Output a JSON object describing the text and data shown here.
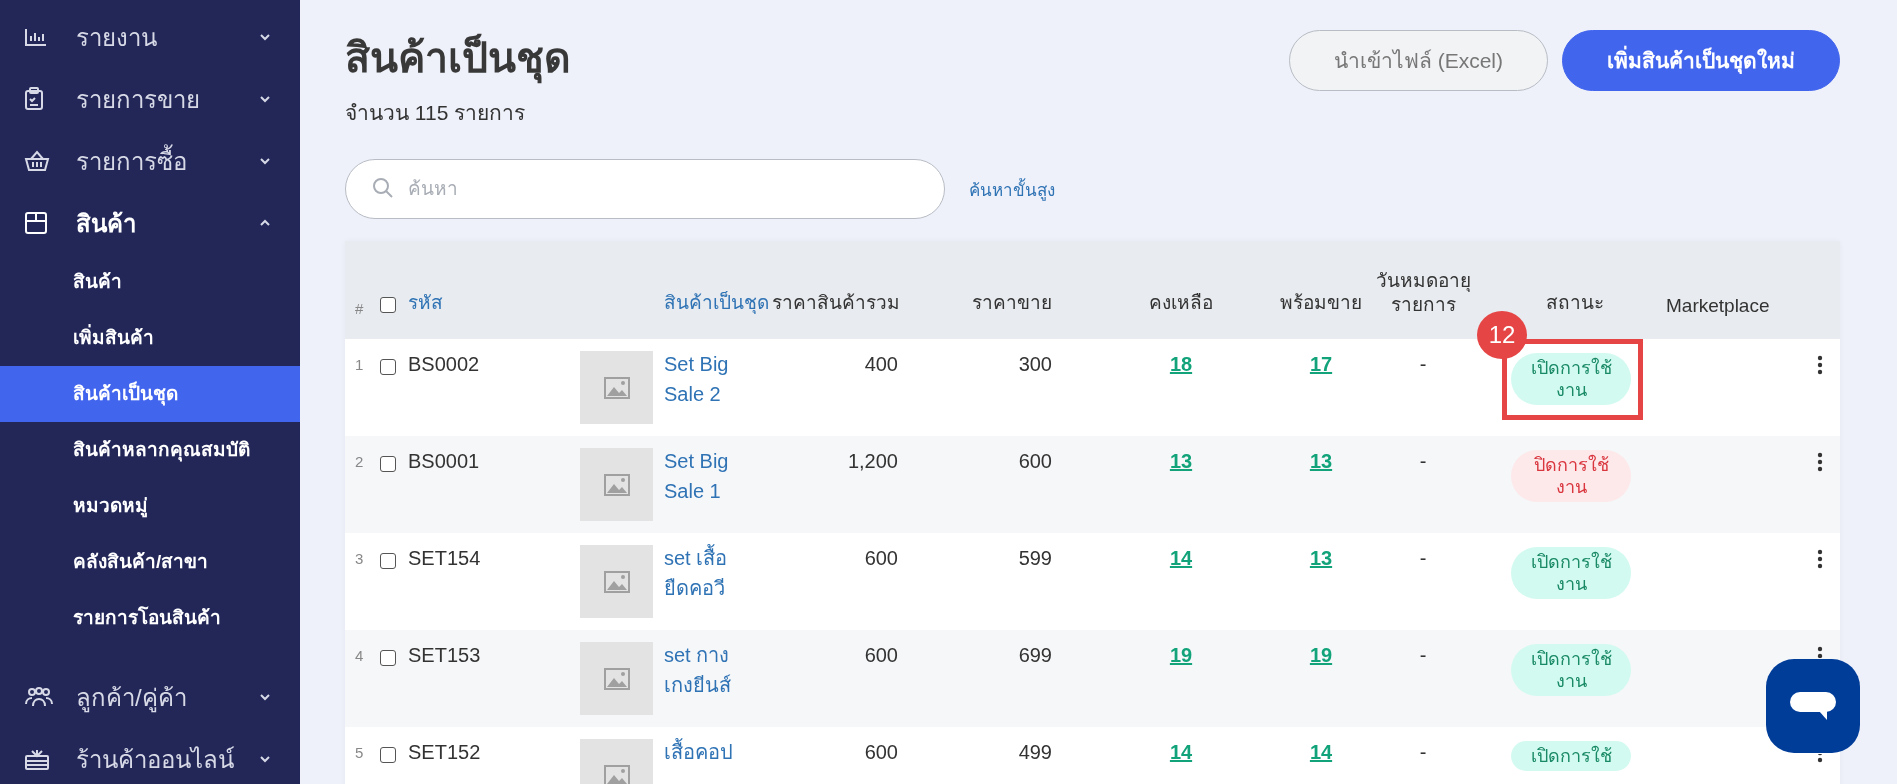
{
  "sidebar": {
    "items": [
      {
        "label": "รายงาน",
        "expanded": false
      },
      {
        "label": "รายการขาย",
        "expanded": false
      },
      {
        "label": "รายการซื้อ",
        "expanded": false
      },
      {
        "label": "สินค้า",
        "expanded": true,
        "children": [
          {
            "label": "สินค้า",
            "selected": false
          },
          {
            "label": "เพิ่มสินค้า",
            "selected": false
          },
          {
            "label": "สินค้าเป็นชุด",
            "selected": true
          },
          {
            "label": "สินค้าหลากคุณสมบัติ",
            "selected": false
          },
          {
            "label": "หมวดหมู่",
            "selected": false
          },
          {
            "label": "คลังสินค้า/สาขา",
            "selected": false
          },
          {
            "label": "รายการโอนสินค้า",
            "selected": false
          }
        ]
      },
      {
        "label": "ลูกค้า/คู่ค้า",
        "expanded": false
      },
      {
        "label": "ร้านค้าออนไลน์",
        "expanded": false
      }
    ]
  },
  "header": {
    "title": "สินค้าเป็นชุด",
    "count": "จำนวน 115 รายการ",
    "import_button": "นำเข้าไฟล์ (Excel)",
    "add_button": "เพิ่มสินค้าเป็นชุดใหม่"
  },
  "search": {
    "placeholder": "ค้นหา",
    "advanced_link": "ค้นหาขั้นสูง"
  },
  "table": {
    "select_all_checked": false,
    "columns": [
      "#",
      "รหัส",
      "สินค้าเป็นชุด",
      "ราคาสินค้ารวม",
      "ราคาขาย",
      "คงเหลือ",
      "พร้อมขาย",
      "วันหมดอายุ รายการ",
      "สถานะ",
      "Marketplace"
    ],
    "rows": [
      {
        "index": "1",
        "checked": false,
        "code": "BS0002",
        "name": "Set Big Sale 2",
        "total_price": "400",
        "sale_price": "300",
        "remaining": "18",
        "ready": "17",
        "expiry": "-",
        "status": "เปิดการใช้งาน",
        "active": true,
        "callout": "12"
      },
      {
        "index": "2",
        "checked": false,
        "code": "BS0001",
        "name": "Set Big Sale 1",
        "total_price": "1,200",
        "sale_price": "600",
        "remaining": "13",
        "ready": "13",
        "expiry": "-",
        "status": "ปิดการใช้งาน",
        "active": false
      },
      {
        "index": "3",
        "checked": false,
        "code": "SET154",
        "name": "set เสื้อยืดคอวี",
        "total_price": "600",
        "sale_price": "599",
        "remaining": "14",
        "ready": "13",
        "expiry": "-",
        "status": "เปิดการใช้งาน",
        "active": true
      },
      {
        "index": "4",
        "checked": false,
        "code": "SET153",
        "name": "set กางเกงยีนส์",
        "total_price": "600",
        "sale_price": "699",
        "remaining": "19",
        "ready": "19",
        "expiry": "-",
        "status": "เปิดการใช้งาน",
        "active": true
      },
      {
        "index": "5",
        "checked": false,
        "code": "SET152",
        "name": "เสื้อคอป",
        "total_price": "600",
        "sale_price": "499",
        "remaining": "14",
        "ready": "14",
        "expiry": "-",
        "status": "เปิดการใช้",
        "active": true
      }
    ]
  }
}
